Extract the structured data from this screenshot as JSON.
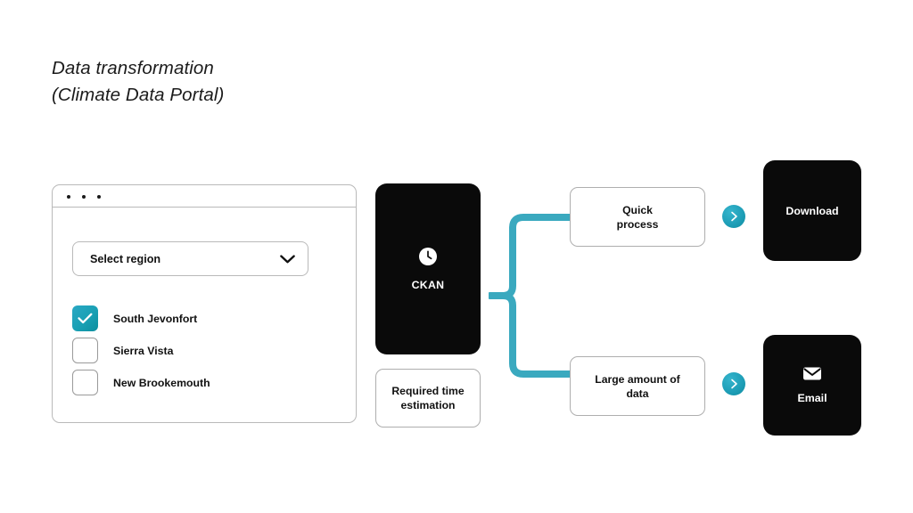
{
  "title": {
    "line1": "Data transformation",
    "line2": "(Climate Data Portal)"
  },
  "browser": {
    "window_dots": [
      "dot",
      "dot",
      "dot"
    ],
    "dropdown": {
      "label": "Select region",
      "icon": "chevron-down-icon"
    },
    "checkboxes": [
      {
        "label": "South Jevonfort",
        "checked": true
      },
      {
        "label": "Sierra Vista",
        "checked": false
      },
      {
        "label": "New Brookemouth",
        "checked": false
      }
    ]
  },
  "flow": {
    "ckan_card": {
      "label": "CKAN",
      "icon": "clock-icon"
    },
    "time_box": {
      "label": "Required time\nestimation",
      "line1": "Required time",
      "line2": "estimation"
    },
    "branches": [
      {
        "label_line1": "Quick",
        "label_line2": "process"
      },
      {
        "label_line1": "Large amount of",
        "label_line2": "data"
      }
    ],
    "outputs": [
      {
        "label": "Download",
        "icon": null
      },
      {
        "label": "Email",
        "icon": "envelope-icon"
      }
    ],
    "arrow_icon": "chevron-right-icon"
  },
  "colors": {
    "accent_teal": "#1f9fb8",
    "accent_teal_light": "#35b4cc",
    "accent_teal_dark": "#0e8ca0",
    "card_black": "#0a0a0a",
    "border_gray": "#aeaeae",
    "background": "#ffffff",
    "text": "#111111"
  }
}
